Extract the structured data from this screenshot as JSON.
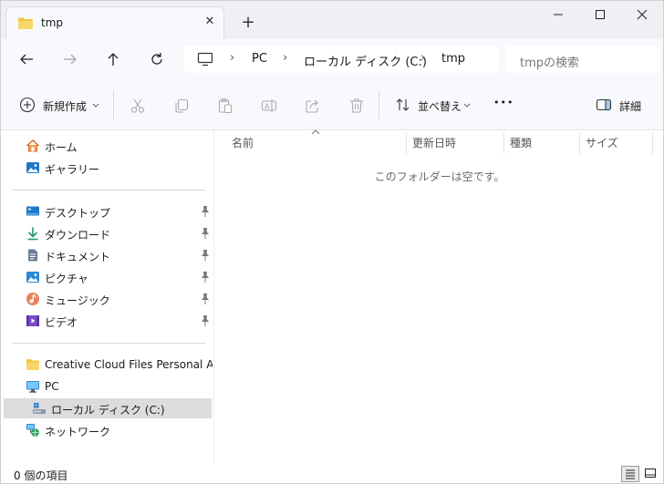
{
  "window": {
    "tab_title": "tmp",
    "new_tab_symbol": "+",
    "tab_close_symbol": "✕"
  },
  "address": {
    "crumbs": [
      "PC",
      "ローカル ディスク (C:)",
      "tmp"
    ],
    "separator": "›",
    "search_placeholder": "tmpの検索"
  },
  "toolbar": {
    "new_label": "新規作成",
    "sort_label": "並べ替え",
    "more_label": "•••",
    "details_label": "詳細"
  },
  "sidebar": {
    "quick": [
      {
        "label": "ホーム",
        "icon": "home-icon"
      },
      {
        "label": "ギャラリー",
        "icon": "gallery-icon"
      }
    ],
    "pinned": [
      {
        "label": "デスクトップ",
        "icon": "desktop-icon"
      },
      {
        "label": "ダウンロード",
        "icon": "download-icon"
      },
      {
        "label": "ドキュメント",
        "icon": "document-icon"
      },
      {
        "label": "ピクチャ",
        "icon": "pictures-icon"
      },
      {
        "label": "ミュージック",
        "icon": "music-icon"
      },
      {
        "label": "ビデオ",
        "icon": "video-icon"
      }
    ],
    "drives": [
      {
        "label": "Creative Cloud Files Personal Account",
        "icon": "folder-icon"
      },
      {
        "label": "PC",
        "icon": "pc-icon"
      },
      {
        "label": "ローカル ディスク (C:)",
        "icon": "drive-icon",
        "selected": true
      },
      {
        "label": "ネットワーク",
        "icon": "network-icon"
      }
    ]
  },
  "content": {
    "columns": [
      "名前",
      "更新日時",
      "種類",
      "サイズ"
    ],
    "empty_message": "このフォルダーは空です。"
  },
  "status": {
    "item_count": "0 個の項目"
  },
  "colors": {
    "folder": "#f4c542",
    "accent": "#0f6cbd",
    "selected_bg": "#dcdcdc"
  }
}
